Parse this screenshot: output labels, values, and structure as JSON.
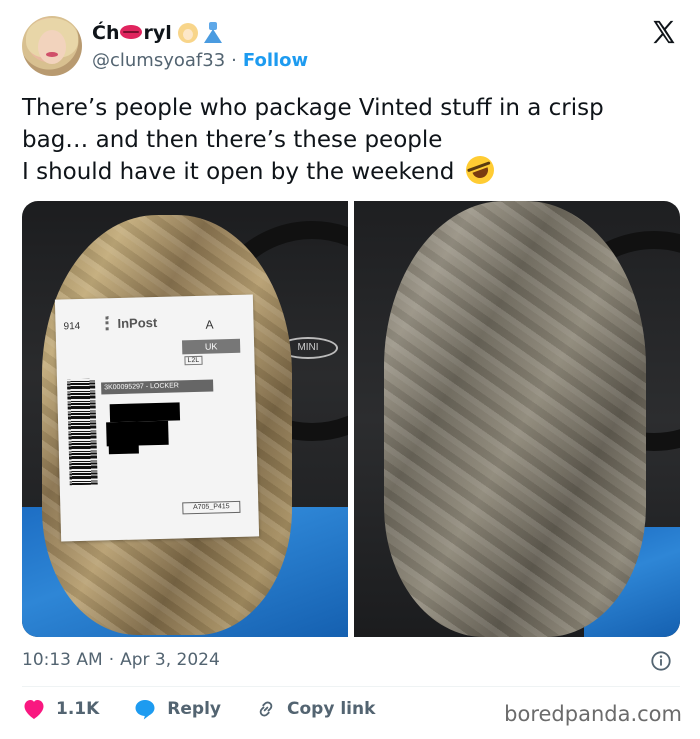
{
  "author": {
    "display_name_prefix": "Ćh",
    "display_name_suffix": "ryl",
    "handle": "@clumsyoaf33",
    "separator": "·",
    "follow_label": "Follow"
  },
  "tweet": {
    "lines": [
      "There’s people who package Vinted stuff in a crisp",
      "bag… and then there’s these people",
      "I should have it open by the weekend"
    ]
  },
  "media": {
    "label": {
      "number": "914",
      "brand": "InPost",
      "letter": "A",
      "country": "UK",
      "sublabel": "L2L",
      "locker": "3K00095297 - LOCKER",
      "code": "A705_P415"
    },
    "car_badge": "MINI"
  },
  "meta": {
    "time": "10:13 AM",
    "separator": "·",
    "date": "Apr 3, 2024"
  },
  "actions": {
    "like_count": "1.1K",
    "reply_label": "Reply",
    "copy_label": "Copy link"
  },
  "watermark": "boredpanda.com",
  "colors": {
    "accent": "#1d9bf0",
    "like": "#f91880",
    "text": "#0f1419",
    "muted": "#536471"
  }
}
